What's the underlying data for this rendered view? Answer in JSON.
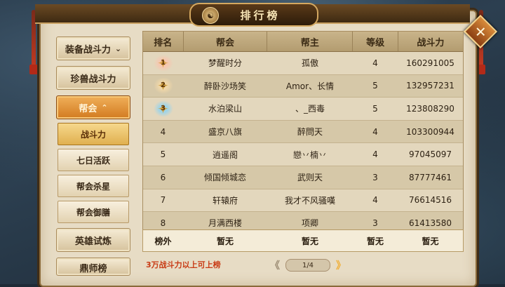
{
  "title": "排行榜",
  "title_emblem": "☯",
  "close_label": "✕",
  "sidebar": {
    "buttons": [
      {
        "label": "装备战斗力",
        "chevron": "⌄"
      },
      {
        "label": "珍兽战斗力"
      },
      {
        "label": "帮会",
        "chevron": "⌃",
        "active": true
      },
      {
        "label": "英雄试炼"
      },
      {
        "label": "鼎师榜"
      }
    ],
    "sub_buttons": [
      {
        "label": "战斗力",
        "active": true
      },
      {
        "label": "七日活跃"
      },
      {
        "label": "帮会杀星"
      },
      {
        "label": "帮会御膳"
      }
    ]
  },
  "table": {
    "headers": [
      "排名",
      "帮会",
      "帮主",
      "等级",
      "战斗力"
    ],
    "rows": [
      {
        "rank": "1",
        "guild": "梦醒时分",
        "leader": "孤傲",
        "level": "4",
        "power": "160291005"
      },
      {
        "rank": "2",
        "guild": "醉卧沙场笑",
        "leader": "Amor、长情",
        "level": "5",
        "power": "132957231"
      },
      {
        "rank": "3",
        "guild": "水泊梁山",
        "leader": "、_西毒",
        "level": "5",
        "power": "123808290"
      },
      {
        "rank": "4",
        "guild": "盛京八旗",
        "leader": "醉問天",
        "level": "4",
        "power": "103300944"
      },
      {
        "rank": "5",
        "guild": "逍遥阁",
        "leader": "戀丷楠丷",
        "level": "4",
        "power": "97045097"
      },
      {
        "rank": "6",
        "guild": "倾国倾城恋",
        "leader": "武则天",
        "level": "3",
        "power": "87777461"
      },
      {
        "rank": "7",
        "guild": "轩辕府",
        "leader": "我才不风骚嘆",
        "level": "4",
        "power": "76614516"
      },
      {
        "rank": "8",
        "guild": "月满西楼",
        "leader": "项卿",
        "level": "3",
        "power": "61413580"
      }
    ]
  },
  "my_row": {
    "rank": "榜外",
    "guild": "暂无",
    "leader": "暂无",
    "level": "暂无",
    "power": "暂无"
  },
  "footer_note": "3万战斗力以上可上榜",
  "pager": {
    "left_arrow": "《",
    "page": "1/4",
    "right_arrow": "》"
  },
  "colors": {
    "accent": "#d27a20",
    "note_red": "#c83a14"
  }
}
